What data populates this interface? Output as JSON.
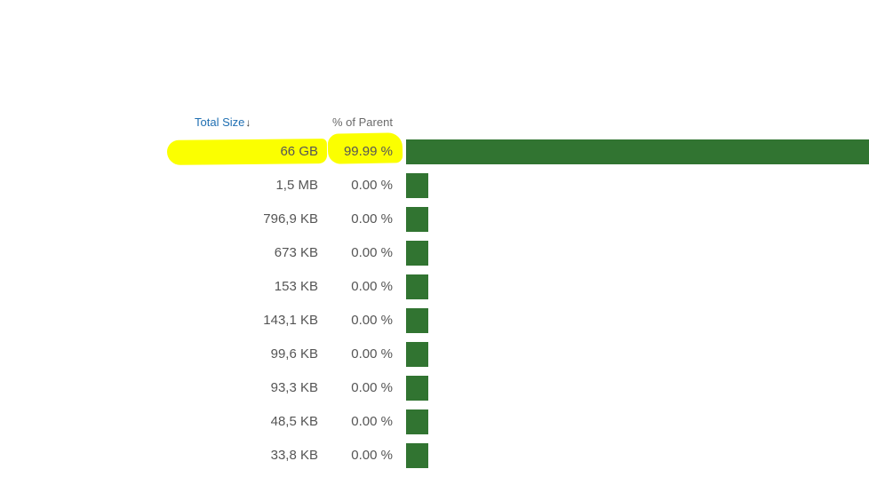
{
  "header": {
    "size_label": "Total Size",
    "sort_glyph": "🡓",
    "sort_icon": "sort-descending-icon",
    "pct_label": "% of Parent"
  },
  "colors": {
    "bar": "#317431",
    "highlight": "#fbff00",
    "header_link": "#1f6fb2"
  },
  "rows": [
    {
      "size": "66 GB",
      "pct": "99.99 %",
      "fraction": 0.9999
    },
    {
      "size": "1,5 MB",
      "pct": "0.00 %",
      "fraction": 0.0
    },
    {
      "size": "796,9 KB",
      "pct": "0.00 %",
      "fraction": 0.0
    },
    {
      "size": "673 KB",
      "pct": "0.00 %",
      "fraction": 0.0
    },
    {
      "size": "153 KB",
      "pct": "0.00 %",
      "fraction": 0.0
    },
    {
      "size": "143,1 KB",
      "pct": "0.00 %",
      "fraction": 0.0
    },
    {
      "size": "99,6 KB",
      "pct": "0.00 %",
      "fraction": 0.0
    },
    {
      "size": "93,3 KB",
      "pct": "0.00 %",
      "fraction": 0.0
    },
    {
      "size": "48,5 KB",
      "pct": "0.00 %",
      "fraction": 0.0
    },
    {
      "size": "33,8 KB",
      "pct": "0.00 %",
      "fraction": 0.0
    }
  ]
}
